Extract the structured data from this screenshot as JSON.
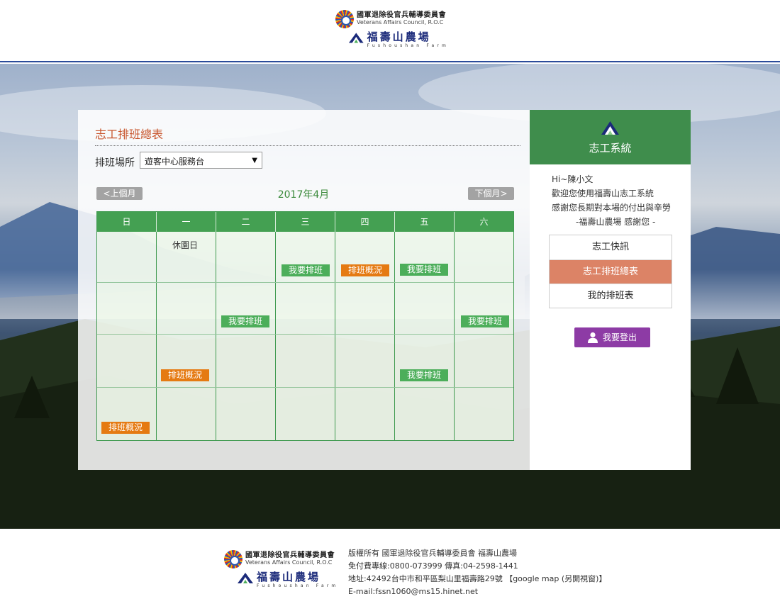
{
  "header": {
    "council_cn": "國軍退除役官兵輔導委員會",
    "council_en": "Veterans Affairs Council, R.O.C",
    "farm_cn": "福壽山農場",
    "farm_en": "Fushoushan Farm"
  },
  "panel": {
    "title": "志工排班總表",
    "location_label": "排班場所",
    "location_selected": "遊客中心服務台",
    "prev_label": "<上個月",
    "next_label": "下個月>",
    "month_label": "2017年4月"
  },
  "calendar": {
    "weekdays": [
      "日",
      "一",
      "二",
      "三",
      "四",
      "五",
      "六"
    ],
    "holiday_label": "休園日",
    "signup_label": "我要排班",
    "overview_label": "排班概況"
  },
  "sidebar": {
    "title": "志工系統",
    "greeting": [
      "Hi~陳小文",
      "歡迎您使用福壽山志工系統",
      "感謝您長期對本場的付出與辛勞",
      "-福壽山農場 感謝您 -"
    ],
    "menu": [
      {
        "label": "志工快訊"
      },
      {
        "label": "志工排班總表"
      },
      {
        "label": "我的排班表"
      }
    ],
    "logout_label": "我要登出"
  },
  "footer": {
    "council_cn": "國軍退除役官兵輔導委員會",
    "council_en": "Veterans Affairs Council, R.O.C",
    "farm_cn": "福壽山農場",
    "farm_en": "Fushoushan Farm",
    "lines": [
      "版權所有 國軍退除役官兵輔導委員會 福壽山農場",
      "免付費專線:0800-073999 傳真:04-2598-1441",
      "地址:42492台中市和平區梨山里福壽路29號 【google map (另開視窗)】",
      "E-mail:fssn1060@ms15.hinet.net"
    ]
  },
  "colors": {
    "accent_orange": "#c8562e",
    "calendar_green": "#44a052",
    "sidebar_green": "#3f8d4c",
    "active_menu": "#dc8366",
    "logout_purple": "#8d3ba5",
    "tag_orange": "#e57a12"
  }
}
